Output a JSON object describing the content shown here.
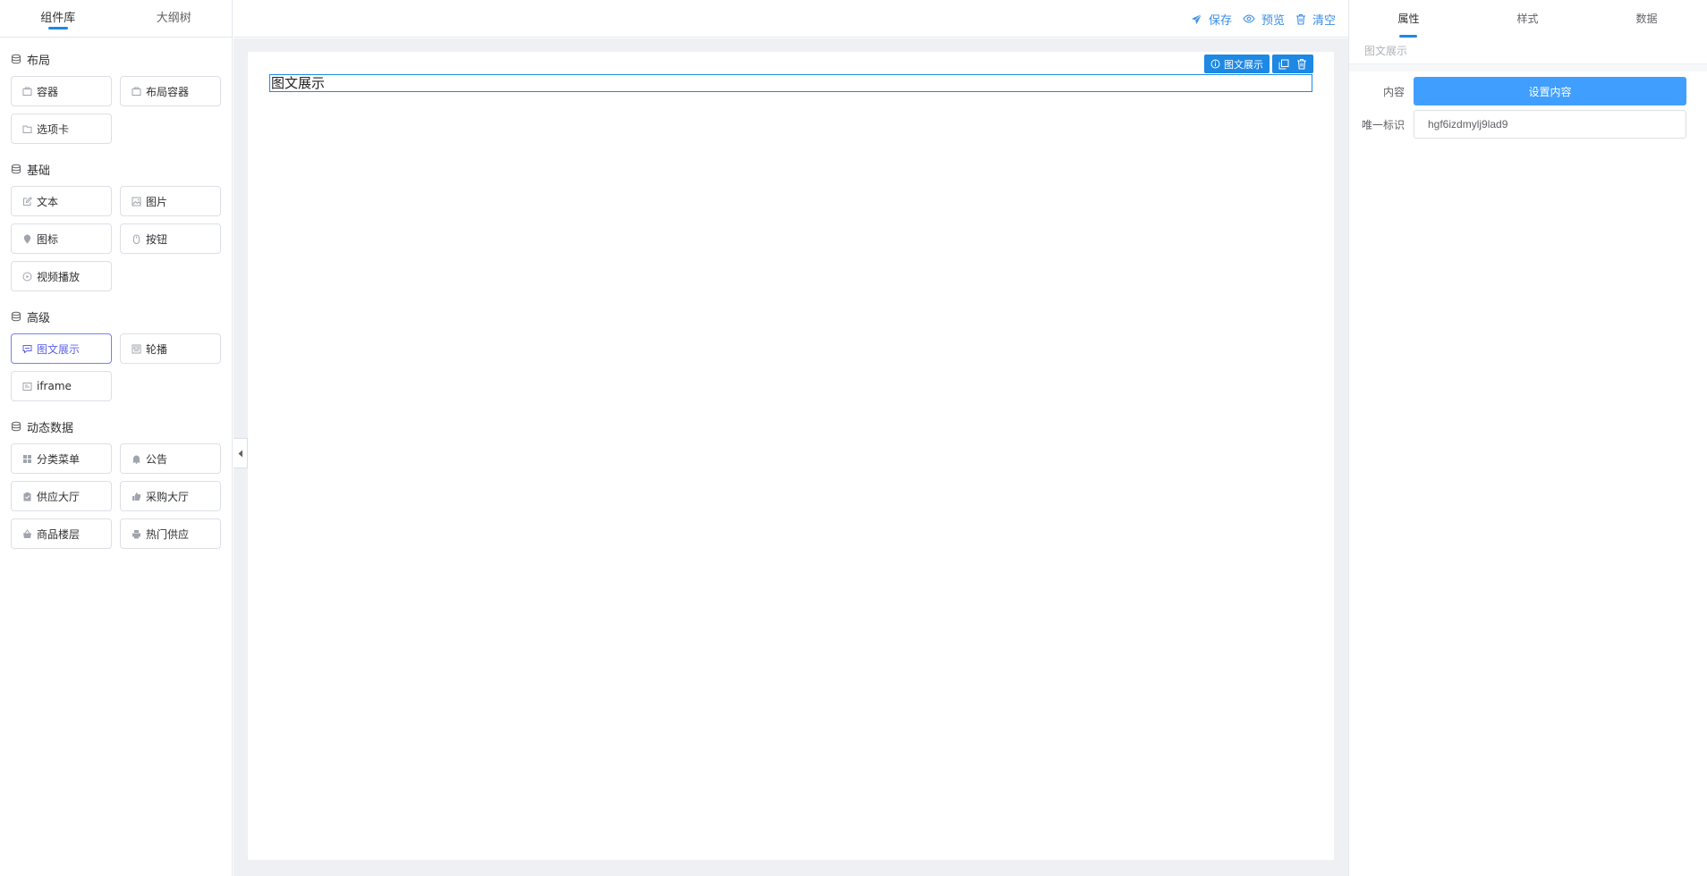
{
  "left_panel": {
    "tabs": [
      {
        "label": "组件库"
      },
      {
        "label": "大纲树"
      }
    ],
    "groups": [
      {
        "title": "布局",
        "items": [
          {
            "label": "容器",
            "icon": "box-icon"
          },
          {
            "label": "布局容器",
            "icon": "box-icon"
          },
          {
            "label": "选项卡",
            "icon": "folder-icon"
          }
        ]
      },
      {
        "title": "基础",
        "items": [
          {
            "label": "文本",
            "icon": "edit-icon"
          },
          {
            "label": "图片",
            "icon": "image-icon"
          },
          {
            "label": "图标",
            "icon": "location-icon"
          },
          {
            "label": "按钮",
            "icon": "mouse-icon"
          },
          {
            "label": "视频播放",
            "icon": "play-icon"
          }
        ]
      },
      {
        "title": "高级",
        "items": [
          {
            "label": "图文展示",
            "icon": "chat-icon"
          },
          {
            "label": "轮播",
            "icon": "carousel-icon"
          },
          {
            "label": "iframe",
            "icon": "frame-icon"
          }
        ]
      },
      {
        "title": "动态数据",
        "items": [
          {
            "label": "分类菜单",
            "icon": "grid-icon"
          },
          {
            "label": "公告",
            "icon": "bell-icon"
          },
          {
            "label": "供应大厅",
            "icon": "clipboard-icon"
          },
          {
            "label": "采购大厅",
            "icon": "thumb-icon"
          },
          {
            "label": "商品楼层",
            "icon": "basket-icon"
          },
          {
            "label": "热门供应",
            "icon": "printer-icon"
          }
        ]
      }
    ],
    "selected_item": "图文展示"
  },
  "toolbar": {
    "save": "保存",
    "preview": "预览",
    "clear": "清空"
  },
  "canvas": {
    "component_text": "图文展示",
    "component_badge": "图文展示"
  },
  "right_panel": {
    "tabs": [
      {
        "label": "属性"
      },
      {
        "label": "样式"
      },
      {
        "label": "数据"
      }
    ],
    "subtitle": "图文展示",
    "content_label": "内容",
    "content_button": "设置内容",
    "id_label": "唯一标识",
    "id_value": "hgf6izdmylj9lad9"
  },
  "colors": {
    "accent": "#1e88e5",
    "primary_button": "#409eff",
    "selected_border": "#7a7ef0"
  }
}
